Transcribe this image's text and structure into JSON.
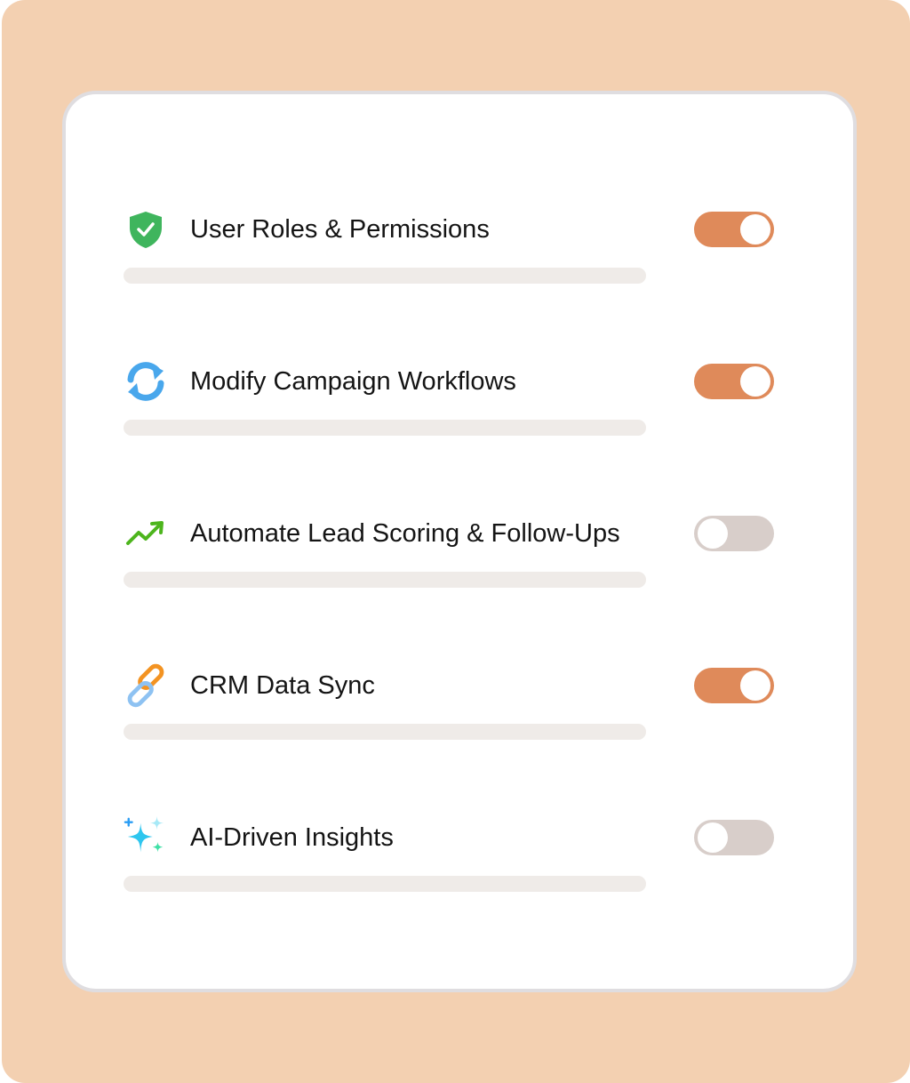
{
  "permissions": [
    {
      "label": "User Roles & Permissions",
      "icon": "shield-check-icon",
      "enabled": true
    },
    {
      "label": "Modify Campaign Workflows",
      "icon": "sync-arrows-icon",
      "enabled": true
    },
    {
      "label": "Automate Lead Scoring & Follow-Ups",
      "icon": "trending-up-icon",
      "enabled": false
    },
    {
      "label": "CRM Data Sync",
      "icon": "link-chain-icon",
      "enabled": true
    },
    {
      "label": "AI-Driven Insights",
      "icon": "sparkles-icon",
      "enabled": false
    }
  ],
  "colors": {
    "background": "#f3d0b1",
    "toggle_on": "#df8a5a",
    "toggle_off": "#d8ceca",
    "placeholder_bar": "#efebe8"
  }
}
